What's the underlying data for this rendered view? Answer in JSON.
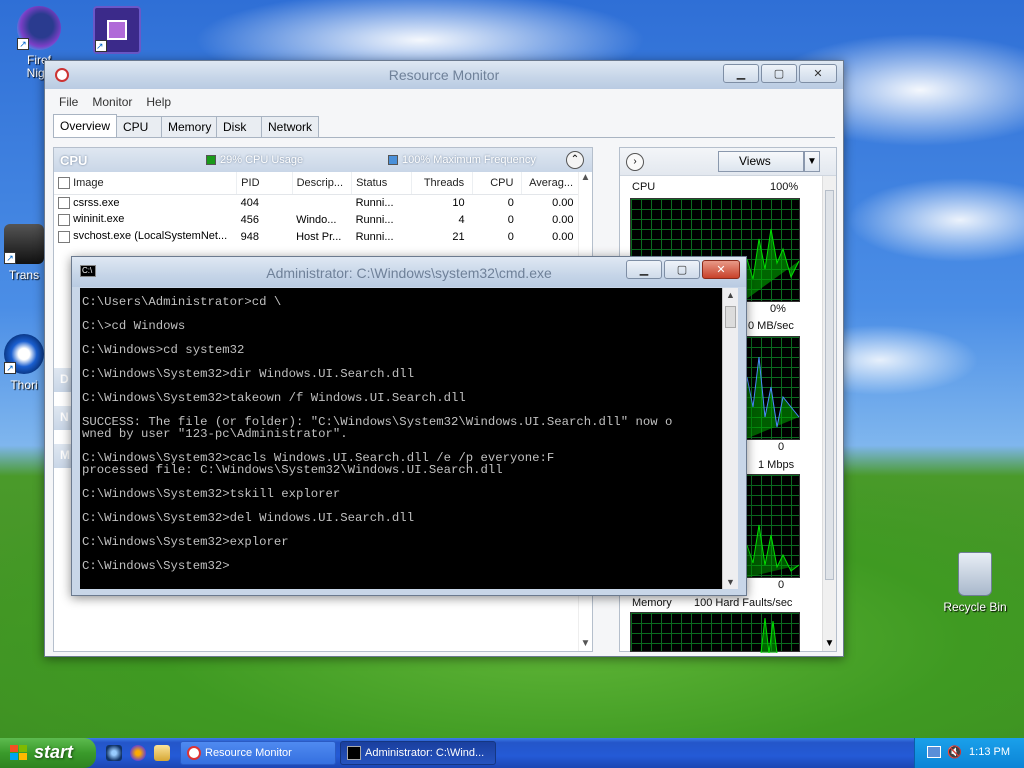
{
  "desktop": {
    "icons": [
      {
        "label": "Firef\nNigh",
        "icon": "firefox-nightly-icon"
      },
      {
        "label": "Trans",
        "icon": "transfer-icon"
      },
      {
        "label": "Thori",
        "icon": "thorium-icon"
      },
      {
        "label": "Recycle Bin",
        "icon": "recycle-bin-icon"
      }
    ]
  },
  "resmon": {
    "title": "Resource Monitor",
    "menu": [
      "File",
      "Monitor",
      "Help"
    ],
    "tabs": [
      "Overview",
      "CPU",
      "Memory",
      "Disk",
      "Network"
    ],
    "cpu_panel": {
      "header": "CPU",
      "usage": "29% CPU Usage",
      "freq": "100% Maximum Frequency",
      "usage_color": "#1a9a1a",
      "freq_color": "#4a90d9",
      "columns": [
        "Image",
        "PID",
        "Descrip...",
        "Status",
        "Threads",
        "CPU",
        "Averag..."
      ],
      "rows": [
        {
          "image": "csrss.exe",
          "pid": "404",
          "desc": "",
          "status": "Runni...",
          "threads": "10",
          "cpu": "0",
          "avg": "0.00"
        },
        {
          "image": "wininit.exe",
          "pid": "456",
          "desc": "Windo...",
          "status": "Runni...",
          "threads": "4",
          "cpu": "0",
          "avg": "0.00"
        },
        {
          "image": "svchost.exe (LocalSystemNet...",
          "pid": "948",
          "desc": "Host Pr...",
          "status": "Runni...",
          "threads": "21",
          "cpu": "0",
          "avg": "0.00"
        }
      ],
      "side_letters": [
        "D",
        "N",
        "M"
      ]
    },
    "graphs": {
      "views_label": "Views",
      "cpu_label": "CPU",
      "cpu_max": "100%",
      "cpu_min": "0%",
      "disk_label": "0 MB/sec",
      "disk_min": "0",
      "net_label": "1 Mbps",
      "net_min": "0",
      "mem_label": "Memory",
      "mem_faults": "100 Hard Faults/sec"
    }
  },
  "cmd": {
    "title": "Administrator: C:\\Windows\\system32\\cmd.exe",
    "lines": [
      "C:\\Users\\Administrator>cd \\",
      "",
      "C:\\>cd Windows",
      "",
      "C:\\Windows>cd system32",
      "",
      "C:\\Windows\\System32>dir Windows.UI.Search.dll",
      "",
      "C:\\Windows\\System32>takeown /f Windows.UI.Search.dll",
      "",
      "SUCCESS: The file (or folder): \"C:\\Windows\\System32\\Windows.UI.Search.dll\" now o",
      "wned by user \"123-pc\\Administrator\".",
      "",
      "C:\\Windows\\System32>cacls Windows.UI.Search.dll /e /p everyone:F",
      "processed file: C:\\Windows\\System32\\Windows.UI.Search.dll",
      "",
      "C:\\Windows\\System32>tskill explorer",
      "",
      "C:\\Windows\\System32>del Windows.UI.Search.dll",
      "",
      "C:\\Windows\\System32>explorer",
      "",
      "C:\\Windows\\System32>"
    ]
  },
  "taskbar": {
    "start_label": "start",
    "tasks": [
      {
        "label": "Resource Monitor",
        "icon": "resource-monitor-icon"
      },
      {
        "label": "Administrator: C:\\Wind...",
        "icon": "cmd-icon"
      }
    ],
    "clock": "1:13 PM"
  },
  "colors": {
    "taskbar_blue": "#245ad6",
    "start_green": "#3a9a2b",
    "graph_green": "#00c000"
  }
}
